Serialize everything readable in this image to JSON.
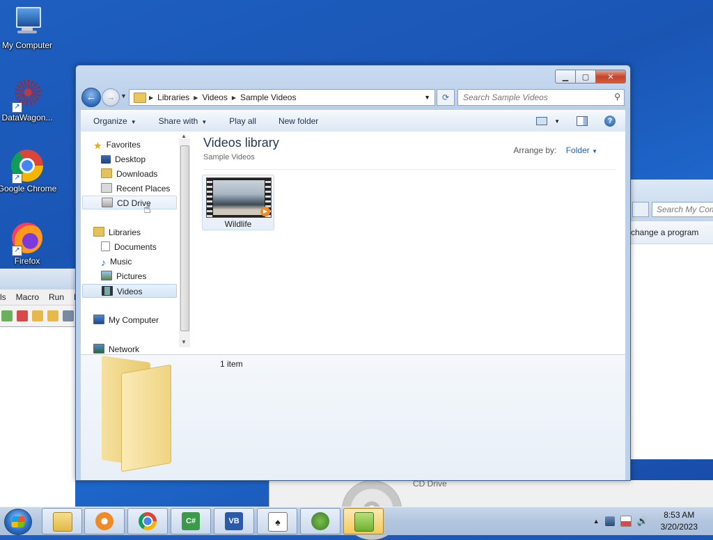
{
  "desktop": {
    "icons": [
      {
        "label": "My Computer"
      },
      {
        "label": "DataWagon..."
      },
      {
        "label": "Google Chrome"
      },
      {
        "label": "Firefox"
      }
    ]
  },
  "background_left_window": {
    "menu": [
      "ls",
      "Macro",
      "Run",
      "P"
    ]
  },
  "background_right_window": {
    "search_placeholder": "Search My Com",
    "command": "change a program"
  },
  "background_bottom": {
    "label": "CD Drive"
  },
  "explorer": {
    "breadcrumb": [
      "Libraries",
      "Videos",
      "Sample Videos"
    ],
    "search_placeholder": "Search Sample Videos",
    "commands": [
      {
        "label": "Organize",
        "dropdown": true
      },
      {
        "label": "Share with",
        "dropdown": true
      },
      {
        "label": "Play all",
        "dropdown": false
      },
      {
        "label": "New folder",
        "dropdown": false
      }
    ],
    "nav": {
      "favorites": {
        "label": "Favorites",
        "items": [
          "Desktop",
          "Downloads",
          "Recent Places",
          "CD Drive"
        ]
      },
      "libraries": {
        "label": "Libraries",
        "items": [
          "Documents",
          "Music",
          "Pictures",
          "Videos"
        ]
      },
      "computer": "My Computer",
      "network": "Network"
    },
    "library": {
      "title": "Videos library",
      "subtitle": "Sample Videos",
      "arrange_by_label": "Arrange by:",
      "arrange_by_value": "Folder"
    },
    "files": [
      {
        "name": "Wildlife"
      }
    ],
    "details": {
      "count": "1 item"
    }
  },
  "taskbar": {
    "time": "8:53 AM",
    "date": "3/20/2023"
  },
  "colors": {
    "desktop": "#1e5fc0",
    "link_accent": "#1b62b8",
    "title_text": "#1e395b"
  }
}
